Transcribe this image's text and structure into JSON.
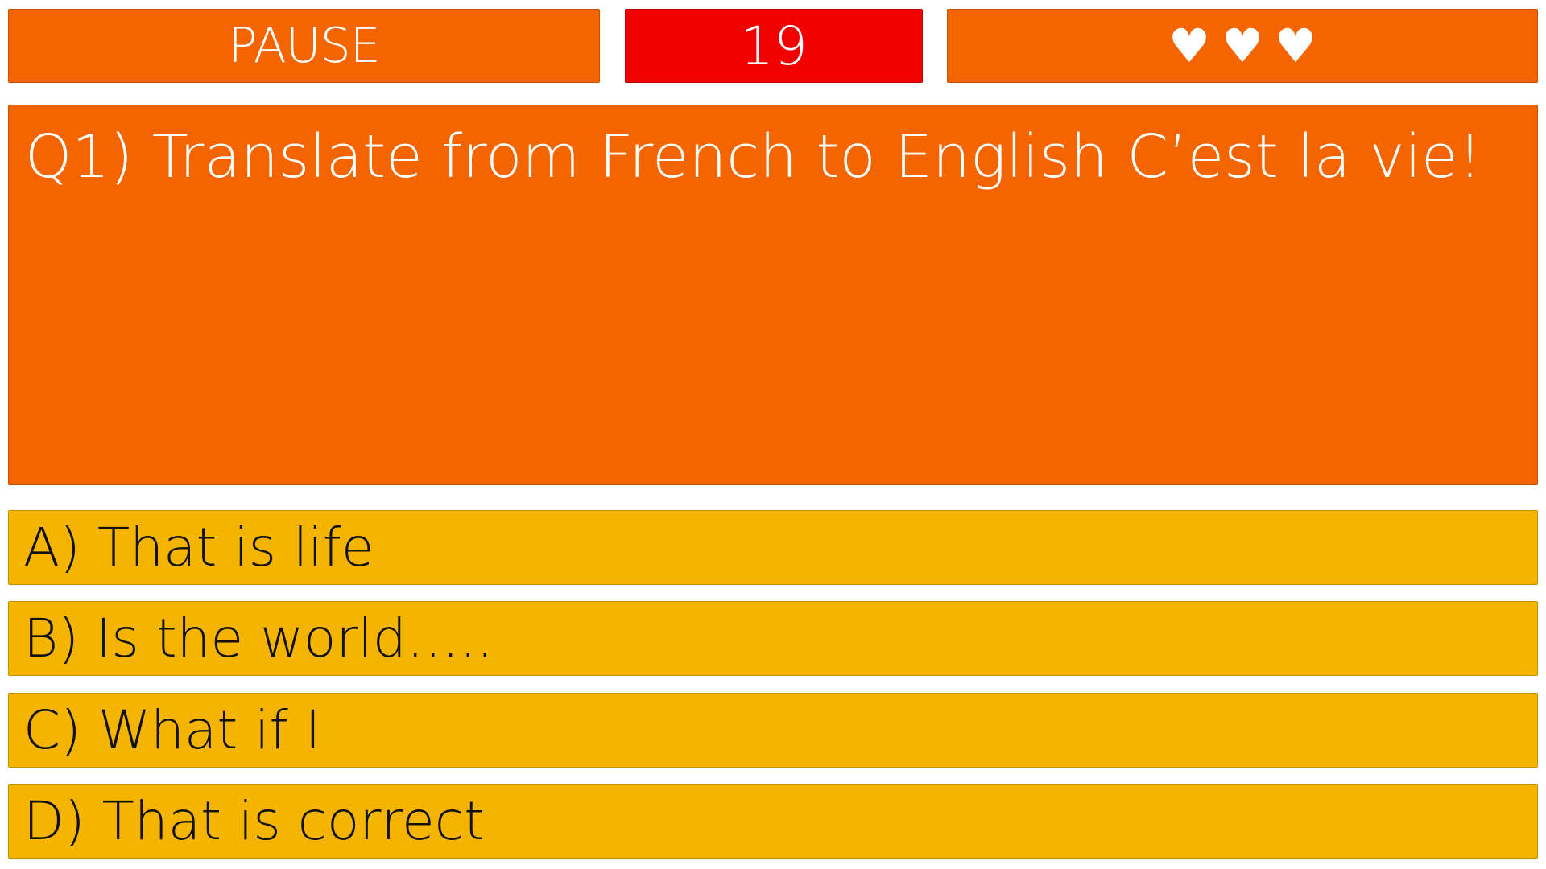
{
  "hud": {
    "pause_label": "PAUSE",
    "timer_value": "19",
    "lives": [
      {
        "icon": "heart-icon",
        "glyph": "♥"
      },
      {
        "icon": "heart-icon",
        "glyph": "♥"
      },
      {
        "icon": "heart-icon",
        "glyph": "♥"
      }
    ]
  },
  "question": {
    "text": "Q1) Translate from French to English C’est la vie!"
  },
  "answers": [
    {
      "label": "A) That is life"
    },
    {
      "label": "B) Is the world….."
    },
    {
      "label": "C) What if I"
    },
    {
      "label": "D) That is correct"
    }
  ],
  "colors": {
    "hud_bg": "#f46400",
    "timer_bg": "#f20000",
    "question_bg": "#f46400",
    "answer_bg": "#f4b400"
  }
}
